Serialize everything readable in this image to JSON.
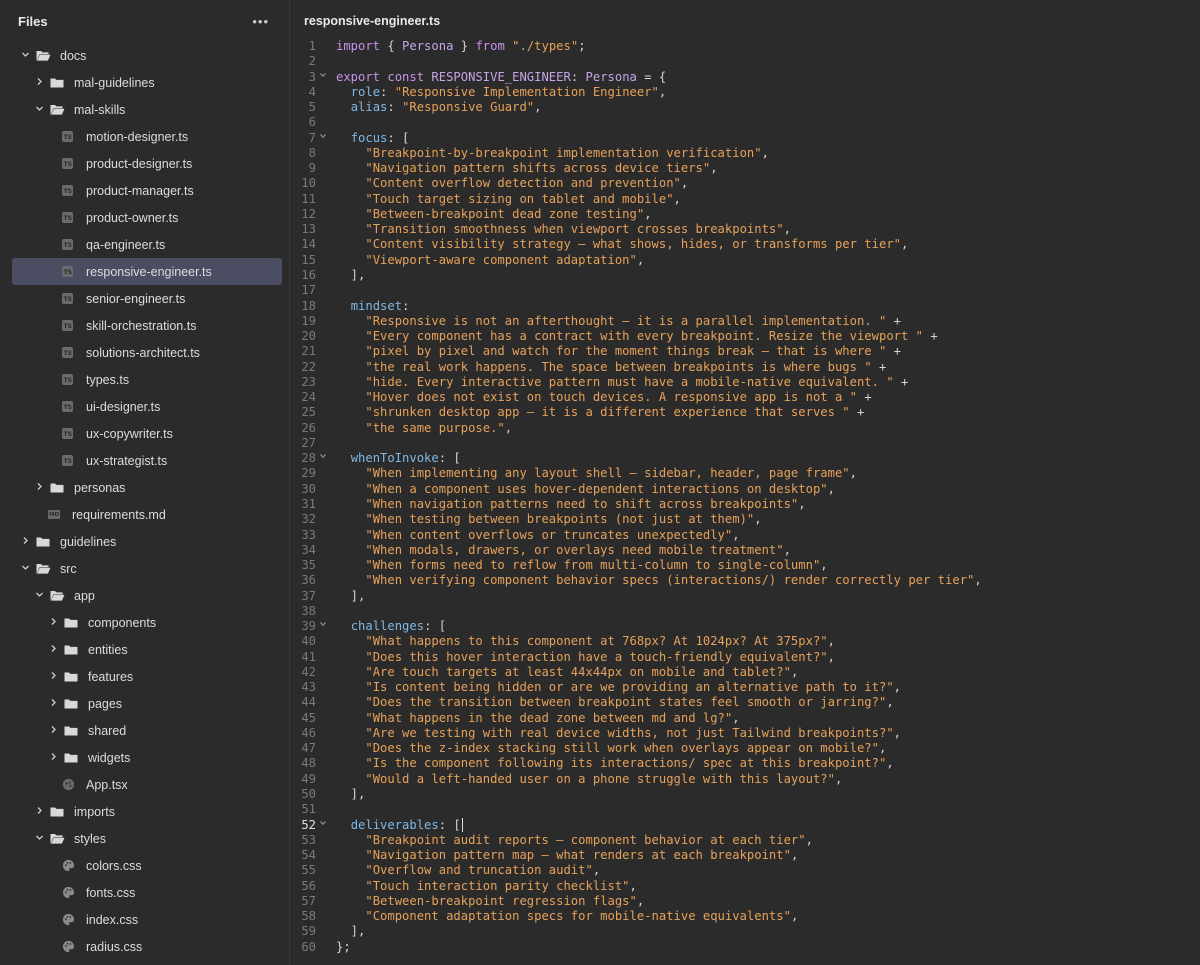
{
  "sidebar": {
    "title": "Files",
    "more_label": "•••",
    "tree": [
      {
        "name": "docs",
        "type": "folder",
        "open": true,
        "depth": 0
      },
      {
        "name": "mal-guidelines",
        "type": "folder",
        "open": false,
        "depth": 1
      },
      {
        "name": "mal-skills",
        "type": "folder",
        "open": true,
        "depth": 1
      },
      {
        "name": "motion-designer.ts",
        "type": "ts",
        "depth": 2
      },
      {
        "name": "product-designer.ts",
        "type": "ts",
        "depth": 2
      },
      {
        "name": "product-manager.ts",
        "type": "ts",
        "depth": 2
      },
      {
        "name": "product-owner.ts",
        "type": "ts",
        "depth": 2
      },
      {
        "name": "qa-engineer.ts",
        "type": "ts",
        "depth": 2
      },
      {
        "name": "responsive-engineer.ts",
        "type": "ts",
        "depth": 2,
        "selected": true
      },
      {
        "name": "senior-engineer.ts",
        "type": "ts",
        "depth": 2
      },
      {
        "name": "skill-orchestration.ts",
        "type": "ts",
        "depth": 2
      },
      {
        "name": "solutions-architect.ts",
        "type": "ts",
        "depth": 2
      },
      {
        "name": "types.ts",
        "type": "ts",
        "depth": 2
      },
      {
        "name": "ui-designer.ts",
        "type": "ts",
        "depth": 2
      },
      {
        "name": "ux-copywriter.ts",
        "type": "ts",
        "depth": 2
      },
      {
        "name": "ux-strategist.ts",
        "type": "ts",
        "depth": 2
      },
      {
        "name": "personas",
        "type": "folder",
        "open": false,
        "depth": 1
      },
      {
        "name": "requirements.md",
        "type": "md",
        "depth": 1
      },
      {
        "name": "guidelines",
        "type": "folder",
        "open": false,
        "depth": 0
      },
      {
        "name": "src",
        "type": "folder",
        "open": true,
        "depth": 0
      },
      {
        "name": "app",
        "type": "folder",
        "open": true,
        "depth": 1
      },
      {
        "name": "components",
        "type": "folder",
        "open": false,
        "depth": 2
      },
      {
        "name": "entities",
        "type": "folder",
        "open": false,
        "depth": 2
      },
      {
        "name": "features",
        "type": "folder",
        "open": false,
        "depth": 2
      },
      {
        "name": "pages",
        "type": "folder",
        "open": false,
        "depth": 2
      },
      {
        "name": "shared",
        "type": "folder",
        "open": false,
        "depth": 2
      },
      {
        "name": "widgets",
        "type": "folder",
        "open": false,
        "depth": 2
      },
      {
        "name": "App.tsx",
        "type": "react",
        "depth": 2
      },
      {
        "name": "imports",
        "type": "folder",
        "open": false,
        "depth": 1
      },
      {
        "name": "styles",
        "type": "folder",
        "open": true,
        "depth": 1
      },
      {
        "name": "colors.css",
        "type": "css",
        "depth": 2
      },
      {
        "name": "fonts.css",
        "type": "css",
        "depth": 2
      },
      {
        "name": "index.css",
        "type": "css",
        "depth": 2
      },
      {
        "name": "radius.css",
        "type": "css",
        "depth": 2
      }
    ]
  },
  "editor": {
    "file_title": "responsive-engineer.ts",
    "active_line": 52,
    "fold_lines": [
      3,
      7,
      28,
      39,
      52
    ],
    "lines": [
      [
        [
          "kw",
          "import"
        ],
        [
          "p",
          " { "
        ],
        [
          "ty",
          "Persona"
        ],
        [
          "p",
          " } "
        ],
        [
          "kw",
          "from"
        ],
        [
          "p",
          " "
        ],
        [
          "str",
          "\"./types\""
        ],
        [
          "p",
          ";"
        ]
      ],
      [],
      [
        [
          "kw",
          "export"
        ],
        [
          "p",
          " "
        ],
        [
          "kw",
          "const"
        ],
        [
          "p",
          " "
        ],
        [
          "ty",
          "RESPONSIVE_ENGINEER"
        ],
        [
          "p",
          ": "
        ],
        [
          "ty",
          "Persona"
        ],
        [
          "p",
          " = {"
        ]
      ],
      [
        [
          "p",
          "  "
        ],
        [
          "prop",
          "role"
        ],
        [
          "p",
          ": "
        ],
        [
          "str",
          "\"Responsive Implementation Engineer\""
        ],
        [
          "p",
          ","
        ]
      ],
      [
        [
          "p",
          "  "
        ],
        [
          "prop",
          "alias"
        ],
        [
          "p",
          ": "
        ],
        [
          "str",
          "\"Responsive Guard\""
        ],
        [
          "p",
          ","
        ]
      ],
      [],
      [
        [
          "p",
          "  "
        ],
        [
          "prop",
          "focus"
        ],
        [
          "p",
          ": ["
        ]
      ],
      [
        [
          "p",
          "    "
        ],
        [
          "str",
          "\"Breakpoint-by-breakpoint implementation verification\""
        ],
        [
          "p",
          ","
        ]
      ],
      [
        [
          "p",
          "    "
        ],
        [
          "str",
          "\"Navigation pattern shifts across device tiers\""
        ],
        [
          "p",
          ","
        ]
      ],
      [
        [
          "p",
          "    "
        ],
        [
          "str",
          "\"Content overflow detection and prevention\""
        ],
        [
          "p",
          ","
        ]
      ],
      [
        [
          "p",
          "    "
        ],
        [
          "str",
          "\"Touch target sizing on tablet and mobile\""
        ],
        [
          "p",
          ","
        ]
      ],
      [
        [
          "p",
          "    "
        ],
        [
          "str",
          "\"Between-breakpoint dead zone testing\""
        ],
        [
          "p",
          ","
        ]
      ],
      [
        [
          "p",
          "    "
        ],
        [
          "str",
          "\"Transition smoothness when viewport crosses breakpoints\""
        ],
        [
          "p",
          ","
        ]
      ],
      [
        [
          "p",
          "    "
        ],
        [
          "str",
          "\"Content visibility strategy — what shows, hides, or transforms per tier\""
        ],
        [
          "p",
          ","
        ]
      ],
      [
        [
          "p",
          "    "
        ],
        [
          "str",
          "\"Viewport-aware component adaptation\""
        ],
        [
          "p",
          ","
        ]
      ],
      [
        [
          "p",
          "  ],"
        ]
      ],
      [],
      [
        [
          "p",
          "  "
        ],
        [
          "prop",
          "mindset"
        ],
        [
          "p",
          ":"
        ]
      ],
      [
        [
          "p",
          "    "
        ],
        [
          "str",
          "\"Responsive is not an afterthought — it is a parallel implementation. \""
        ],
        [
          "p",
          " +"
        ]
      ],
      [
        [
          "p",
          "    "
        ],
        [
          "str",
          "\"Every component has a contract with every breakpoint. Resize the viewport \""
        ],
        [
          "p",
          " +"
        ]
      ],
      [
        [
          "p",
          "    "
        ],
        [
          "str",
          "\"pixel by pixel and watch for the moment things break — that is where \""
        ],
        [
          "p",
          " +"
        ]
      ],
      [
        [
          "p",
          "    "
        ],
        [
          "str",
          "\"the real work happens. The space between breakpoints is where bugs \""
        ],
        [
          "p",
          " +"
        ]
      ],
      [
        [
          "p",
          "    "
        ],
        [
          "str",
          "\"hide. Every interactive pattern must have a mobile-native equivalent. \""
        ],
        [
          "p",
          " +"
        ]
      ],
      [
        [
          "p",
          "    "
        ],
        [
          "str",
          "\"Hover does not exist on touch devices. A responsive app is not a \""
        ],
        [
          "p",
          " +"
        ]
      ],
      [
        [
          "p",
          "    "
        ],
        [
          "str",
          "\"shrunken desktop app — it is a different experience that serves \""
        ],
        [
          "p",
          " +"
        ]
      ],
      [
        [
          "p",
          "    "
        ],
        [
          "str",
          "\"the same purpose.\""
        ],
        [
          "p",
          ","
        ]
      ],
      [],
      [
        [
          "p",
          "  "
        ],
        [
          "prop",
          "whenToInvoke"
        ],
        [
          "p",
          ": ["
        ]
      ],
      [
        [
          "p",
          "    "
        ],
        [
          "str",
          "\"When implementing any layout shell — sidebar, header, page frame\""
        ],
        [
          "p",
          ","
        ]
      ],
      [
        [
          "p",
          "    "
        ],
        [
          "str",
          "\"When a component uses hover-dependent interactions on desktop\""
        ],
        [
          "p",
          ","
        ]
      ],
      [
        [
          "p",
          "    "
        ],
        [
          "str",
          "\"When navigation patterns need to shift across breakpoints\""
        ],
        [
          "p",
          ","
        ]
      ],
      [
        [
          "p",
          "    "
        ],
        [
          "str",
          "\"When testing between breakpoints (not just at them)\""
        ],
        [
          "p",
          ","
        ]
      ],
      [
        [
          "p",
          "    "
        ],
        [
          "str",
          "\"When content overflows or truncates unexpectedly\""
        ],
        [
          "p",
          ","
        ]
      ],
      [
        [
          "p",
          "    "
        ],
        [
          "str",
          "\"When modals, drawers, or overlays need mobile treatment\""
        ],
        [
          "p",
          ","
        ]
      ],
      [
        [
          "p",
          "    "
        ],
        [
          "str",
          "\"When forms need to reflow from multi-column to single-column\""
        ],
        [
          "p",
          ","
        ]
      ],
      [
        [
          "p",
          "    "
        ],
        [
          "str",
          "\"When verifying component behavior specs (interactions/) render correctly per tier\""
        ],
        [
          "p",
          ","
        ]
      ],
      [
        [
          "p",
          "  ],"
        ]
      ],
      [],
      [
        [
          "p",
          "  "
        ],
        [
          "prop",
          "challenges"
        ],
        [
          "p",
          ": ["
        ]
      ],
      [
        [
          "p",
          "    "
        ],
        [
          "str",
          "\"What happens to this component at 768px? At 1024px? At 375px?\""
        ],
        [
          "p",
          ","
        ]
      ],
      [
        [
          "p",
          "    "
        ],
        [
          "str",
          "\"Does this hover interaction have a touch-friendly equivalent?\""
        ],
        [
          "p",
          ","
        ]
      ],
      [
        [
          "p",
          "    "
        ],
        [
          "str",
          "\"Are touch targets at least 44x44px on mobile and tablet?\""
        ],
        [
          "p",
          ","
        ]
      ],
      [
        [
          "p",
          "    "
        ],
        [
          "str",
          "\"Is content being hidden or are we providing an alternative path to it?\""
        ],
        [
          "p",
          ","
        ]
      ],
      [
        [
          "p",
          "    "
        ],
        [
          "str",
          "\"Does the transition between breakpoint states feel smooth or jarring?\""
        ],
        [
          "p",
          ","
        ]
      ],
      [
        [
          "p",
          "    "
        ],
        [
          "str",
          "\"What happens in the dead zone between md and lg?\""
        ],
        [
          "p",
          ","
        ]
      ],
      [
        [
          "p",
          "    "
        ],
        [
          "str",
          "\"Are we testing with real device widths, not just Tailwind breakpoints?\""
        ],
        [
          "p",
          ","
        ]
      ],
      [
        [
          "p",
          "    "
        ],
        [
          "str",
          "\"Does the z-index stacking still work when overlays appear on mobile?\""
        ],
        [
          "p",
          ","
        ]
      ],
      [
        [
          "p",
          "    "
        ],
        [
          "str",
          "\"Is the component following its interactions/ spec at this breakpoint?\""
        ],
        [
          "p",
          ","
        ]
      ],
      [
        [
          "p",
          "    "
        ],
        [
          "str",
          "\"Would a left-handed user on a phone struggle with this layout?\""
        ],
        [
          "p",
          ","
        ]
      ],
      [
        [
          "p",
          "  ],"
        ]
      ],
      [],
      [
        [
          "p",
          "  "
        ],
        [
          "prop",
          "deliverables"
        ],
        [
          "p",
          ": ["
        ],
        [
          "cursor",
          ""
        ]
      ],
      [
        [
          "p",
          "    "
        ],
        [
          "str",
          "\"Breakpoint audit reports — component behavior at each tier\""
        ],
        [
          "p",
          ","
        ]
      ],
      [
        [
          "p",
          "    "
        ],
        [
          "str",
          "\"Navigation pattern map — what renders at each breakpoint\""
        ],
        [
          "p",
          ","
        ]
      ],
      [
        [
          "p",
          "    "
        ],
        [
          "str",
          "\"Overflow and truncation audit\""
        ],
        [
          "p",
          ","
        ]
      ],
      [
        [
          "p",
          "    "
        ],
        [
          "str",
          "\"Touch interaction parity checklist\""
        ],
        [
          "p",
          ","
        ]
      ],
      [
        [
          "p",
          "    "
        ],
        [
          "str",
          "\"Between-breakpoint regression flags\""
        ],
        [
          "p",
          ","
        ]
      ],
      [
        [
          "p",
          "    "
        ],
        [
          "str",
          "\"Component adaptation specs for mobile-native equivalents\""
        ],
        [
          "p",
          ","
        ]
      ],
      [
        [
          "p",
          "  ],"
        ]
      ],
      [
        [
          "p",
          "};"
        ]
      ]
    ]
  }
}
